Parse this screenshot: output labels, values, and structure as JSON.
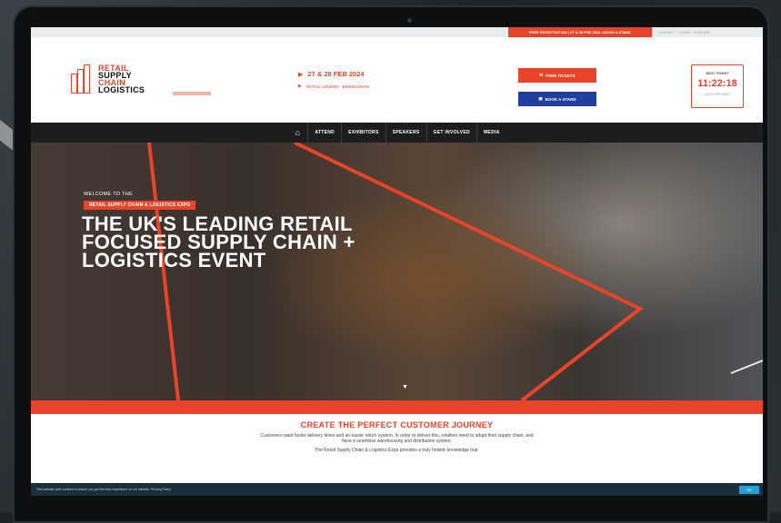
{
  "topbar": {
    "cta": "FREE REGISTRATION | 27 & 28 FEB 2024 | BOOK A STAND",
    "links": "CONTACT · LOGIN · ENQUIRE"
  },
  "logo": {
    "line1": "RETAIL",
    "line2": "SUPPLY",
    "line3": "CHAIN",
    "line4": "LOGISTICS"
  },
  "event": {
    "date": "27 & 28 FEB 2024",
    "venue": "RETAIL LONDON · BIRMINGHAM"
  },
  "buttons": {
    "ticket": "FREE TICKETS",
    "stand": "BOOK A STAND"
  },
  "countdown": {
    "label": "NEXT EVENT",
    "time": "11:22:18",
    "sub": "DAYS HRS MINS"
  },
  "nav": {
    "items": [
      "ATTEND",
      "EXHIBITORS",
      "SPEAKERS",
      "GET INVOLVED",
      "MEDIA"
    ]
  },
  "hero": {
    "welcome": "WELCOME TO THE",
    "badge": "RETAIL SUPPLY CHAIN & LOGISTICS EXPO",
    "headline_1": "THE UK'S LEADING RETAIL",
    "headline_2": "FOCUSED SUPPLY CHAIN +",
    "headline_3": "LOGISTICS EVENT"
  },
  "content": {
    "title": "CREATE THE PERFECT CUSTOMER JOURNEY",
    "body": "Customers want faster delivery times and an easier return system. In order to deliver this, retailers need to adapt their supply chain, and have a seamless warehousing and distribution system.",
    "body2": "The Retail Supply Chain & Logistics Expo provides a truly holistic knowledge hub."
  },
  "cookie": {
    "text": "This website uses cookies to ensure you get the best experience on our website. Privacy Policy",
    "button": "OK"
  },
  "colors": {
    "accent": "#e8442a",
    "blue": "#1f3fa0",
    "nav": "#1b1d1f"
  }
}
